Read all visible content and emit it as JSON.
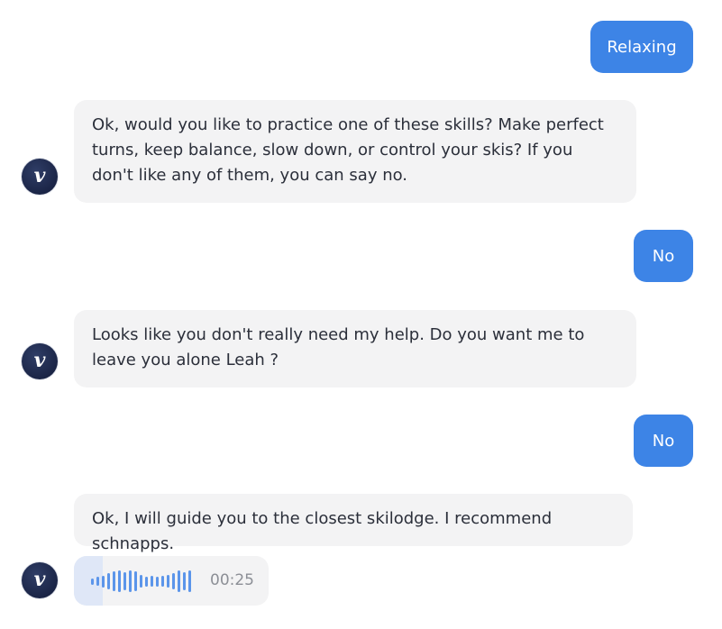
{
  "messages": {
    "user_1": "Relaxing",
    "bot_1": "Ok, would you like to practice one of these skills? Make perfect turns, keep balance, slow down, or control your skis? If you don't like any of them, you can say no.",
    "user_2": "No",
    "bot_2": "Looks like you don't really need my help. Do you want me to leave you alone Leah ?",
    "user_3": "No",
    "bot_3": "Ok, I will guide you to the closest skilodge. I recommend schnapps."
  },
  "avatar": {
    "letter": "v",
    "icon": "bot-logo-icon"
  },
  "audio": {
    "duration": "00:25",
    "progress_fraction": 0.15,
    "waveform_levels": [
      0.3,
      0.4,
      0.55,
      0.75,
      0.9,
      1.0,
      0.85,
      1.0,
      0.9,
      0.6,
      0.45,
      0.5,
      0.45,
      0.5,
      0.6,
      0.75,
      1.0,
      0.85,
      1.0
    ]
  },
  "colors": {
    "user_bubble": "#3d84e6",
    "bot_bubble": "#f3f3f4",
    "waveform": "#5b95ea"
  }
}
